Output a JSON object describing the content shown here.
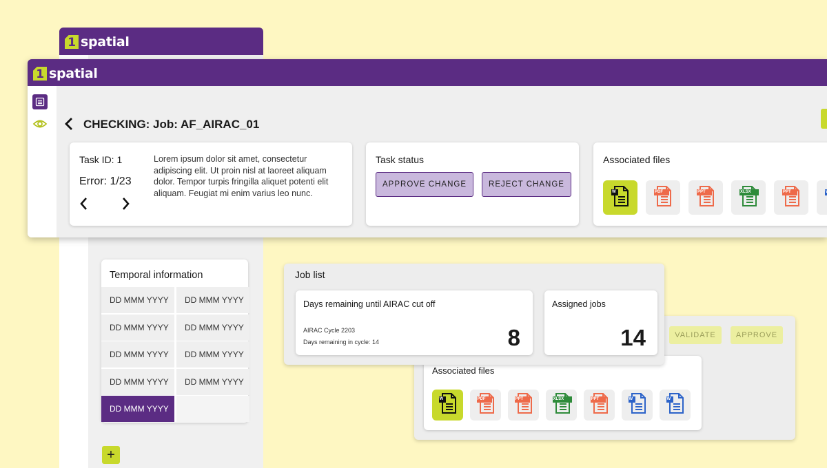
{
  "brand": {
    "name": "spatial",
    "mark": "1"
  },
  "colors": {
    "purple": "#5b2c83",
    "lime": "#c8d92c",
    "background": "#fef7c2",
    "pdf": "#ee6a4a",
    "xlsx": "#2e8b3a",
    "word": "#2c63c9"
  },
  "header": {
    "back_icon": "chevron-left-icon",
    "title": "CHECKING: Job: AF_AIRAC_01"
  },
  "sidebar": {
    "icons": [
      "list-icon",
      "eye-icon"
    ]
  },
  "task_card": {
    "task_id": "Task ID: 1",
    "error": "Error: 1/23",
    "description": "Lorem ipsum dolor sit amet, consectetur adipiscing elit. Ut proin nisl at laoreet aliquam dolor. Tempor turpis fringilla aliquet potenti elit aliquam. Feugiat mi enim varius leo nunc."
  },
  "task_status": {
    "title": "Task status",
    "approve_label": "APPROVE CHANGE",
    "reject_label": "REJECT CHANGE"
  },
  "associated_files_top": {
    "title": "Associated files",
    "files": [
      {
        "type": "W",
        "kind": "word",
        "selected": true
      },
      {
        "type": "PDF",
        "kind": "pdf"
      },
      {
        "type": "PPT",
        "kind": "pdf"
      },
      {
        "type": "XLSX",
        "kind": "xlsx"
      },
      {
        "type": "PPT",
        "kind": "pdf"
      },
      {
        "type": "W",
        "kind": "word"
      }
    ]
  },
  "temporal": {
    "title": "Temporal information",
    "rows": [
      [
        "DD MMM YYYY",
        "DD MMM YYYY"
      ],
      [
        "DD MMM YYYY",
        "DD MMM YYYY"
      ],
      [
        "DD MMM YYYY",
        "DD MMM YYYY"
      ],
      [
        "DD MMM YYYY",
        "DD MMM YYYY"
      ],
      [
        "DD MMM YYYY",
        ""
      ]
    ],
    "add_label": "+"
  },
  "job_list": {
    "title": "Job list",
    "days_card": {
      "title": "Days remaining until AIRAC cut off",
      "cycle": "AIRAC Cycle 2203",
      "days_in_cycle": "Days remaining in cycle: 14",
      "value": "8"
    },
    "assigned_card": {
      "title": "Assigned jobs",
      "value": "14"
    }
  },
  "validation_panel": {
    "validate_label": "VALIDATE",
    "approve_label": "APPROVE",
    "files_title": "Associated files",
    "files": [
      {
        "type": "W",
        "kind": "word",
        "selected": true
      },
      {
        "type": "PDF",
        "kind": "pdf"
      },
      {
        "type": "PPT",
        "kind": "pdf"
      },
      {
        "type": "XLSX",
        "kind": "xlsx"
      },
      {
        "type": "PPT",
        "kind": "pdf"
      },
      {
        "type": "W",
        "kind": "word"
      },
      {
        "type": "W",
        "kind": "word"
      }
    ]
  }
}
